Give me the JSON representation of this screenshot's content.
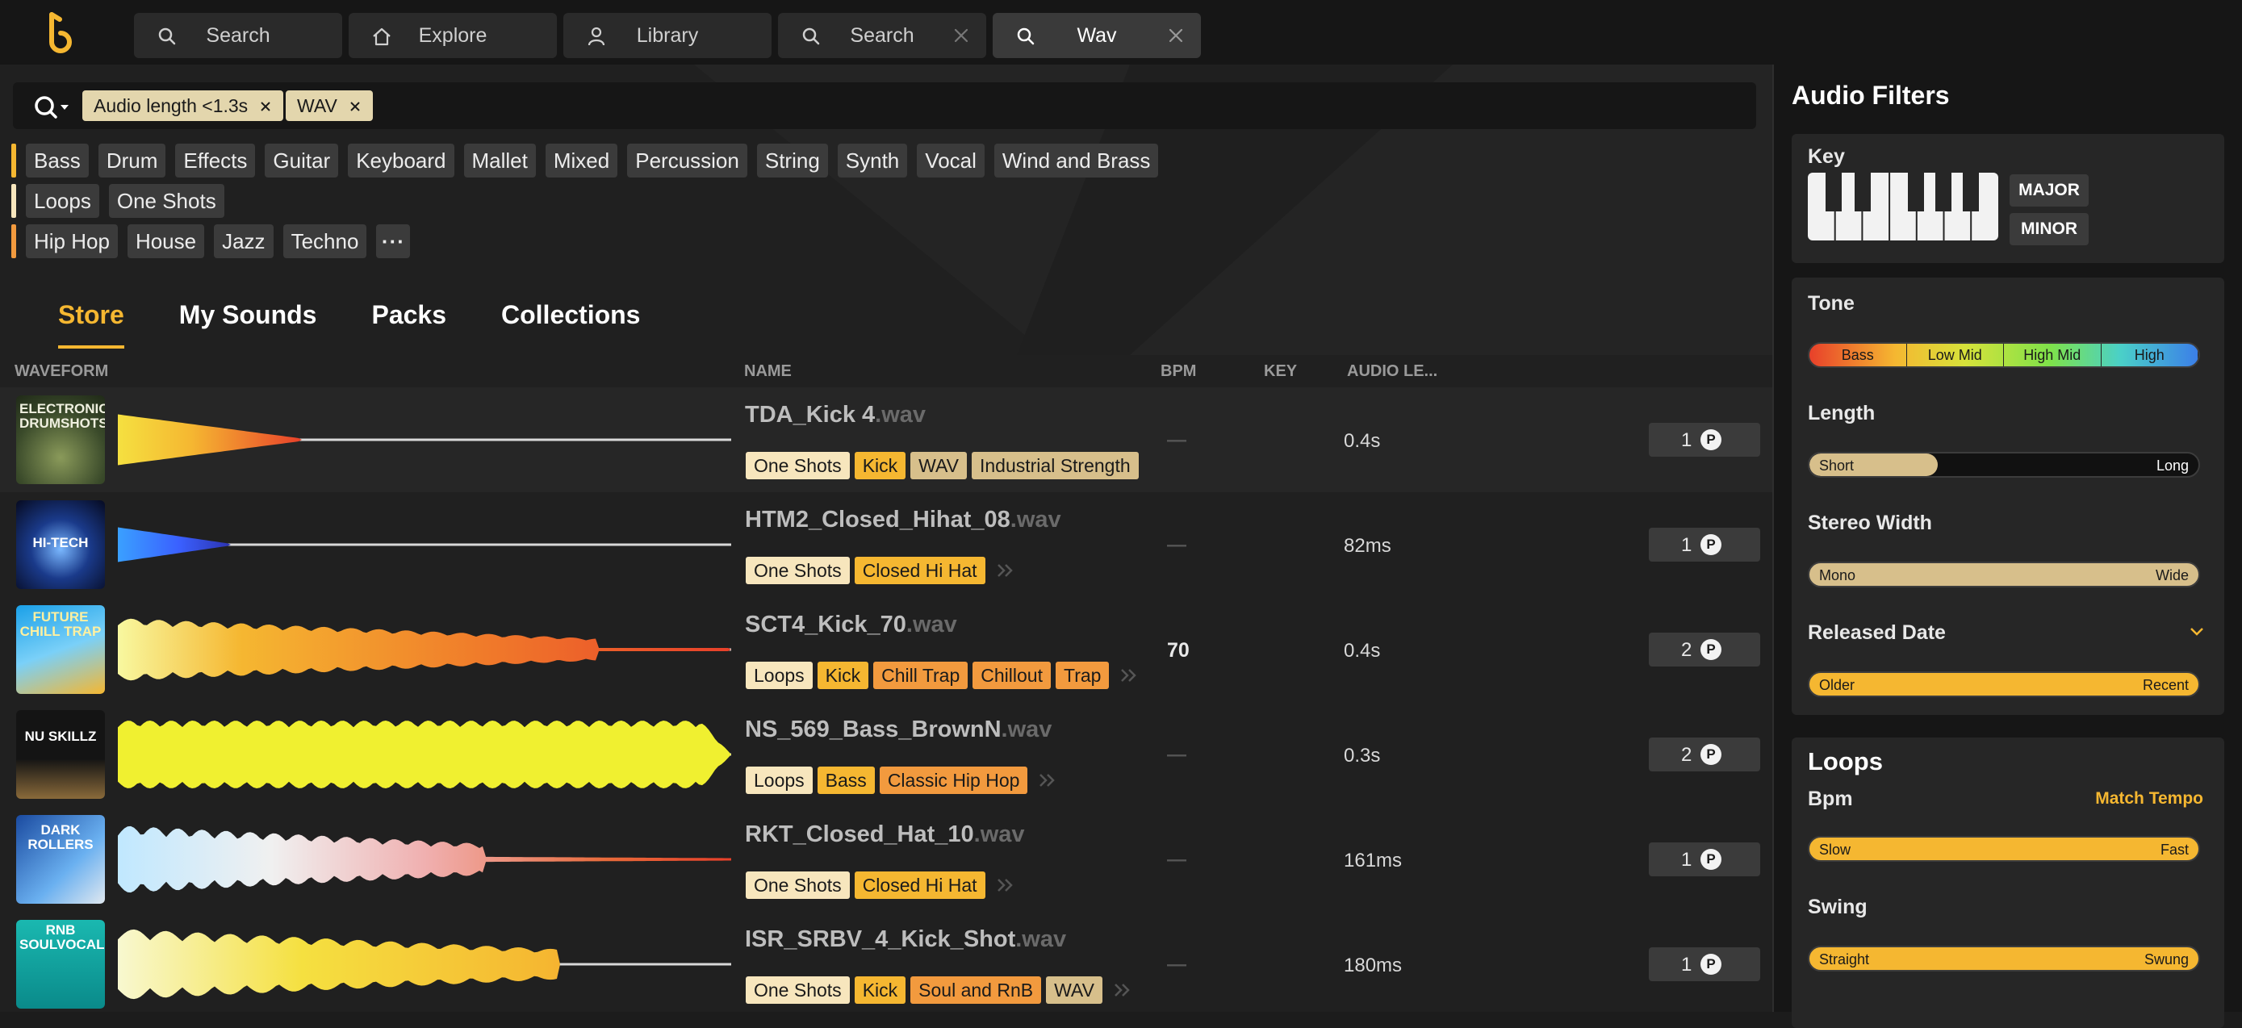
{
  "nav": {
    "tabs": [
      {
        "label": "Search",
        "icon": "search-icon"
      },
      {
        "label": "Explore",
        "icon": "home-icon"
      },
      {
        "label": "Library",
        "icon": "user-icon"
      },
      {
        "label": "Search",
        "icon": "search-icon"
      },
      {
        "label": "Wav",
        "icon": "search-icon"
      }
    ]
  },
  "search": {
    "chips": [
      "Audio length <1.3s",
      "WAV"
    ]
  },
  "filters": {
    "instruments": [
      "Bass",
      "Drum",
      "Effects",
      "Guitar",
      "Keyboard",
      "Mallet",
      "Mixed",
      "Percussion",
      "String",
      "Synth",
      "Vocal",
      "Wind and Brass"
    ],
    "types": [
      "Loops",
      "One Shots"
    ],
    "genres": [
      "Hip Hop",
      "House",
      "Jazz",
      "Techno"
    ],
    "more": "···",
    "colors": {
      "instruments": "#f5b731",
      "types": "#f7e6bd",
      "genres": "#f29a3e"
    }
  },
  "main_tabs": [
    "Store",
    "My Sounds",
    "Packs",
    "Collections"
  ],
  "columns": {
    "waveform": "WAVEFORM",
    "name": "NAME",
    "bpm": "BPM",
    "key": "KEY",
    "audio_length": "AUDIO LE..."
  },
  "rows": [
    {
      "cover": "ELECTRONIC DRUMSHOTS",
      "name": "TDA_Kick 4",
      "ext": ".wav",
      "tags": [
        {
          "t": "One Shots",
          "k": "cat"
        },
        {
          "t": "Kick",
          "k": "inst"
        },
        {
          "t": "WAV",
          "k": "fmt"
        },
        {
          "t": "Industrial Strength",
          "k": "fmt"
        }
      ],
      "bpm": "—",
      "length": "0.4s",
      "credits": "1",
      "chevron": false
    },
    {
      "cover": "HI-TECH",
      "name": "HTM2_Closed_Hihat_08",
      "ext": ".wav",
      "tags": [
        {
          "t": "One Shots",
          "k": "cat"
        },
        {
          "t": "Closed Hi Hat",
          "k": "inst"
        }
      ],
      "bpm": "—",
      "length": "82ms",
      "credits": "1",
      "chevron": true
    },
    {
      "cover": "FUTURE CHILL TRAP",
      "name": "SCT4_Kick_70",
      "ext": ".wav",
      "tags": [
        {
          "t": "Loops",
          "k": "cat"
        },
        {
          "t": "Kick",
          "k": "inst"
        },
        {
          "t": "Chill Trap",
          "k": "genre"
        },
        {
          "t": "Chillout",
          "k": "genre"
        },
        {
          "t": "Trap",
          "k": "genre"
        }
      ],
      "bpm": "70",
      "length": "0.4s",
      "credits": "2",
      "chevron": true
    },
    {
      "cover": "NU SKILLZ",
      "name": "NS_569_Bass_BrownN",
      "ext": ".wav",
      "tags": [
        {
          "t": "Loops",
          "k": "cat"
        },
        {
          "t": "Bass",
          "k": "inst"
        },
        {
          "t": "Classic Hip Hop",
          "k": "genre"
        }
      ],
      "bpm": "—",
      "length": "0.3s",
      "credits": "2",
      "chevron": true
    },
    {
      "cover": "DARK ROLLERS",
      "name": "RKT_Closed_Hat_10",
      "ext": ".wav",
      "tags": [
        {
          "t": "One Shots",
          "k": "cat"
        },
        {
          "t": "Closed Hi Hat",
          "k": "inst"
        }
      ],
      "bpm": "—",
      "length": "161ms",
      "credits": "1",
      "chevron": true
    },
    {
      "cover": "RNB SOULVOCALS",
      "name": "ISR_SRBV_4_Kick_Shot",
      "ext": ".wav",
      "tags": [
        {
          "t": "One Shots",
          "k": "cat"
        },
        {
          "t": "Kick",
          "k": "inst"
        },
        {
          "t": "Soul and RnB",
          "k": "genre"
        },
        {
          "t": "WAV",
          "k": "fmt"
        }
      ],
      "bpm": "—",
      "length": "180ms",
      "credits": "1",
      "chevron": true
    }
  ],
  "credit_symbol": "P",
  "audio_filters": {
    "title": "Audio Filters",
    "key": {
      "label": "Key",
      "major": "MAJOR",
      "minor": "MINOR"
    },
    "tone": {
      "label": "Tone",
      "segments": [
        {
          "label": "Bass",
          "color": "#f07a2a"
        },
        {
          "label": "Low Mid",
          "color": "#d7e23a"
        },
        {
          "label": "High Mid",
          "color": "#7ee24a"
        },
        {
          "label": "High",
          "color": "#4ab8e8"
        }
      ]
    },
    "length": {
      "label": "Length",
      "low": "Short",
      "high": "Long",
      "fill": 0.33
    },
    "stereo": {
      "label": "Stereo Width",
      "low": "Mono",
      "high": "Wide"
    },
    "released": {
      "label": "Released Date",
      "low": "Older",
      "high": "Recent"
    }
  },
  "loops": {
    "title": "Loops",
    "bpm": {
      "label": "Bpm",
      "match": "Match Tempo",
      "low": "Slow",
      "high": "Fast"
    },
    "swing": {
      "label": "Swing",
      "low": "Straight",
      "high": "Swung"
    }
  },
  "accent": "#f5b731"
}
